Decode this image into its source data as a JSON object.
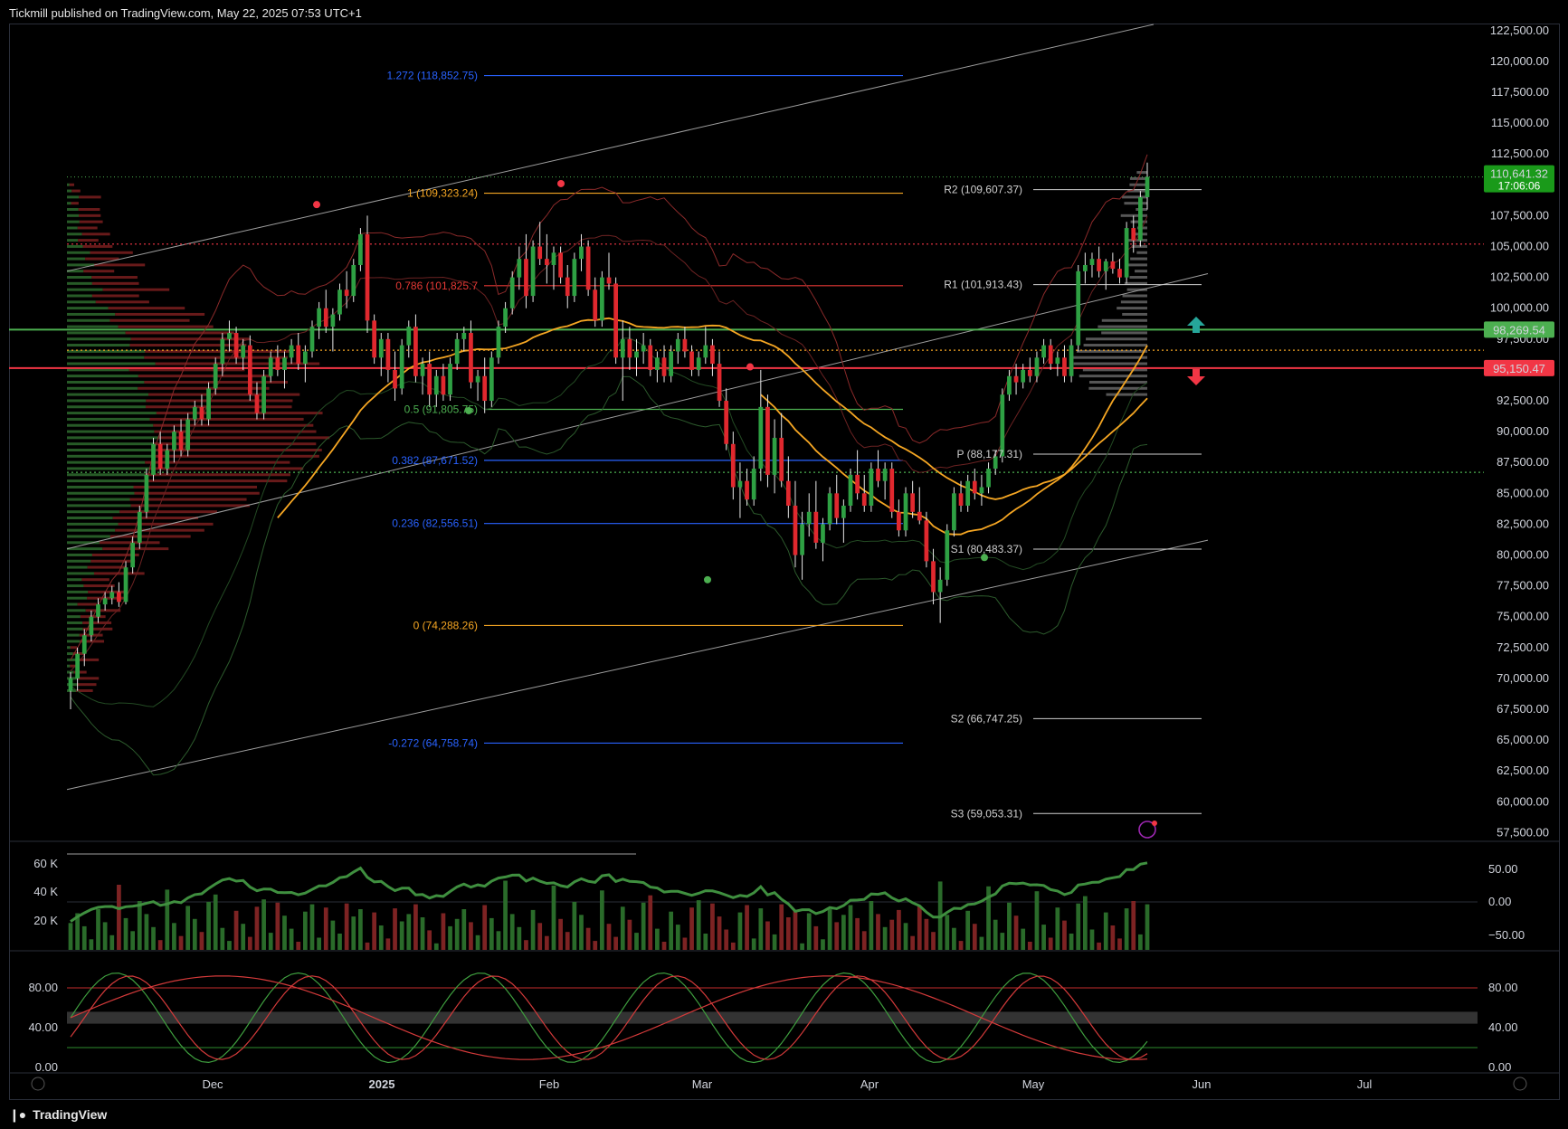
{
  "header": {
    "publisher_line": "Tickmill published on TradingView.com, May 22, 2025 07:53 UTC+1"
  },
  "footer": {
    "brand": "TradingView",
    "logo_icon": "tradingview-logo-icon"
  },
  "colors": {
    "up": "#2e8b2e",
    "down": "#c42b2b",
    "fib_blue": "#2962ff",
    "fib_orange": "#f5a623",
    "fib_red": "#e53935",
    "support": "#4caf50",
    "resistance": "#f23645",
    "ma": "#f5a623"
  },
  "chart_data": [
    {
      "type": "candlestick",
      "symbol_pane": "price",
      "y_axis_ticks": [
        "122,500.00",
        "120,000.00",
        "117,500.00",
        "115,000.00",
        "112,500.00",
        "110,000.00",
        "107,500.00",
        "105,000.00",
        "102,500.00",
        "100,000.00",
        "97,500.00",
        "92,500.00",
        "90,000.00",
        "87,500.00",
        "85,000.00",
        "82,500.00",
        "80,000.00",
        "77,500.00",
        "75,000.00",
        "72,500.00",
        "70,000.00",
        "67,500.00",
        "65,000.00",
        "62,500.00",
        "60,000.00",
        "57,500.00"
      ],
      "ylim": [
        56800,
        123000
      ],
      "x_axis_ticks": [
        "Dec",
        "2025",
        "Feb",
        "Mar",
        "Apr",
        "May",
        "Jun",
        "Jul"
      ],
      "last_price": {
        "value": "110,641.32",
        "countdown": "17:06:06"
      },
      "price_labels": [
        {
          "value": "98,269.54",
          "color": "#4caf50"
        },
        {
          "value": "95,150.47",
          "color": "#f23645"
        }
      ],
      "fib_levels": [
        {
          "label": "1.272 (118,852.75)",
          "value": 118852.75,
          "color": "#2962ff"
        },
        {
          "label": "1 (109,323.24)",
          "value": 109323.24,
          "color": "#f5a623"
        },
        {
          "label": "0.786 (101,825.7",
          "value": 101825.7,
          "color": "#e53935"
        },
        {
          "label": "0.5 (91,805.75)",
          "value": 91805.75,
          "color": "#4caf50"
        },
        {
          "label": "0.382 (87,671.52)",
          "value": 87671.52,
          "color": "#2962ff"
        },
        {
          "label": "0.236 (82,556.51)",
          "value": 82556.51,
          "color": "#2962ff"
        },
        {
          "label": "0 (74,288.26)",
          "value": 74288.26,
          "color": "#f5a623"
        },
        {
          "label": "-0.272 (64,758.74)",
          "value": 64758.74,
          "color": "#2962ff"
        }
      ],
      "pivots": [
        {
          "label": "R2 (109,607.37)",
          "value": 109607.37
        },
        {
          "label": "R1 (101,913.43)",
          "value": 101913.43
        },
        {
          "label": "P (88,177.31)",
          "value": 88177.31
        },
        {
          "label": "S1 (80,483.37)",
          "value": 80483.37
        },
        {
          "label": "S2 (66,747.25)",
          "value": 66747.25
        },
        {
          "label": "S3 (59,053.31)",
          "value": 59053.31
        }
      ],
      "candles_ohlc": [
        [
          69000,
          70500,
          67500,
          70000
        ],
        [
          70000,
          72500,
          69000,
          72000
        ],
        [
          72000,
          74000,
          71000,
          73500
        ],
        [
          73500,
          75500,
          73000,
          75000
        ],
        [
          75000,
          76500,
          74500,
          76000
        ],
        [
          76000,
          77000,
          75500,
          76500
        ],
        [
          76500,
          77500,
          76000,
          77000
        ],
        [
          77000,
          77800,
          75800,
          76200
        ],
        [
          76200,
          79500,
          76000,
          79000
        ],
        [
          79000,
          81500,
          78500,
          81000
        ],
        [
          81000,
          84000,
          80500,
          83500
        ],
        [
          83500,
          87000,
          83000,
          86500
        ],
        [
          86500,
          89500,
          86000,
          89000
        ],
        [
          89000,
          90000,
          86500,
          87000
        ],
        [
          87000,
          89000,
          86500,
          88500
        ],
        [
          88500,
          90500,
          87500,
          90000
        ],
        [
          90000,
          91000,
          88000,
          88500
        ],
        [
          88500,
          91500,
          88000,
          91000
        ],
        [
          91000,
          92500,
          90500,
          92000
        ],
        [
          92000,
          93000,
          90500,
          91000
        ],
        [
          91000,
          94000,
          90500,
          93500
        ],
        [
          93500,
          96000,
          93000,
          95500
        ],
        [
          95500,
          98000,
          94500,
          97500
        ],
        [
          97500,
          99000,
          96500,
          98000
        ],
        [
          98000,
          98500,
          95500,
          96000
        ],
        [
          96000,
          97500,
          95000,
          97000
        ],
        [
          97000,
          97800,
          92500,
          93000
        ],
        [
          93000,
          94000,
          91000,
          91500
        ],
        [
          91500,
          95000,
          91000,
          94500
        ],
        [
          94500,
          96500,
          94000,
          96000
        ],
        [
          96000,
          97000,
          94500,
          95000
        ],
        [
          95000,
          96500,
          93500,
          96000
        ],
        [
          96000,
          97500,
          95500,
          97000
        ],
        [
          97000,
          98000,
          95000,
          95500
        ],
        [
          95500,
          97000,
          94000,
          96500
        ],
        [
          96500,
          99000,
          96000,
          98500
        ],
        [
          98500,
          100500,
          97500,
          100000
        ],
        [
          100000,
          101500,
          98000,
          98500
        ],
        [
          98500,
          100000,
          96500,
          99500
        ],
        [
          99500,
          102000,
          99000,
          101500
        ],
        [
          101500,
          103000,
          100000,
          101000
        ],
        [
          101000,
          104000,
          100500,
          103500
        ],
        [
          103500,
          106500,
          103000,
          106000
        ],
        [
          106000,
          107500,
          98000,
          99000
        ],
        [
          99000,
          99500,
          95500,
          96000
        ],
        [
          96000,
          98000,
          94500,
          97500
        ],
        [
          97500,
          98000,
          94000,
          95000
        ],
        [
          95000,
          96500,
          92500,
          93500
        ],
        [
          93500,
          97500,
          93000,
          97000
        ],
        [
          97000,
          99000,
          96000,
          98500
        ],
        [
          98500,
          99500,
          94000,
          94500
        ],
        [
          94500,
          96000,
          93000,
          95500
        ],
        [
          95500,
          96500,
          92000,
          93000
        ],
        [
          93000,
          95000,
          92000,
          94500
        ],
        [
          94500,
          95500,
          92500,
          93000
        ],
        [
          93000,
          96000,
          92500,
          95500
        ],
        [
          95500,
          98000,
          95000,
          97500
        ],
        [
          97500,
          98500,
          96500,
          98000
        ],
        [
          98000,
          99000,
          93500,
          94000
        ],
        [
          94000,
          95000,
          92500,
          94500
        ],
        [
          94500,
          96000,
          91500,
          92500
        ],
        [
          92500,
          96500,
          92000,
          96000
        ],
        [
          96000,
          99000,
          95500,
          98500
        ],
        [
          98500,
          100500,
          98000,
          100000
        ],
        [
          100000,
          103000,
          99500,
          102500
        ],
        [
          102500,
          105000,
          101500,
          104000
        ],
        [
          104000,
          106000,
          100000,
          101000
        ],
        [
          101000,
          105500,
          100500,
          105000
        ],
        [
          105000,
          107000,
          103500,
          104000
        ],
        [
          104000,
          106000,
          102000,
          103500
        ],
        [
          103500,
          105000,
          101500,
          104500
        ],
        [
          104500,
          105000,
          102000,
          102500
        ],
        [
          102500,
          103500,
          100000,
          101000
        ],
        [
          101000,
          104500,
          100500,
          104000
        ],
        [
          104000,
          106000,
          103000,
          105000
        ],
        [
          105000,
          105500,
          101000,
          101500
        ],
        [
          101500,
          102500,
          98500,
          99000
        ],
        [
          99000,
          103000,
          98500,
          102500
        ],
        [
          102500,
          104500,
          101500,
          102000
        ],
        [
          102000,
          102500,
          95500,
          96000
        ],
        [
          96000,
          99000,
          92500,
          97500
        ],
        [
          97500,
          98500,
          95000,
          96000
        ],
        [
          96000,
          97500,
          94500,
          96500
        ],
        [
          96500,
          98000,
          95500,
          97000
        ],
        [
          97000,
          97500,
          94500,
          95000
        ],
        [
          95000,
          96500,
          94000,
          96000
        ],
        [
          96000,
          97000,
          94000,
          94500
        ],
        [
          94500,
          97000,
          94000,
          96500
        ],
        [
          96500,
          98000,
          95500,
          97500
        ],
        [
          97500,
          98500,
          96000,
          96500
        ],
        [
          96500,
          97000,
          94500,
          95000
        ],
        [
          95000,
          96500,
          94500,
          96000
        ],
        [
          96000,
          98500,
          95500,
          97000
        ],
        [
          97000,
          97500,
          94500,
          95500
        ],
        [
          95500,
          96500,
          92000,
          92500
        ],
        [
          92500,
          93500,
          88500,
          89000
        ],
        [
          89000,
          90000,
          84500,
          85500
        ],
        [
          85500,
          87500,
          83000,
          86000
        ],
        [
          86000,
          87000,
          84000,
          84500
        ],
        [
          84500,
          88000,
          84000,
          87000
        ],
        [
          87000,
          95000,
          86000,
          92000
        ],
        [
          92000,
          93000,
          85500,
          86500
        ],
        [
          86500,
          91000,
          85000,
          89500
        ],
        [
          89500,
          91500,
          85500,
          86000
        ],
        [
          86000,
          88000,
          83000,
          84000
        ],
        [
          84000,
          86000,
          79000,
          80000
        ],
        [
          80000,
          83500,
          78000,
          82500
        ],
        [
          82500,
          85000,
          81500,
          83500
        ],
        [
          83500,
          86000,
          80500,
          81000
        ],
        [
          81000,
          83000,
          79500,
          82500
        ],
        [
          82500,
          85500,
          82000,
          85000
        ],
        [
          85000,
          86500,
          82500,
          83000
        ],
        [
          83000,
          84500,
          81000,
          84000
        ],
        [
          84000,
          87000,
          83500,
          86500
        ],
        [
          86500,
          88500,
          84500,
          85000
        ],
        [
          85000,
          86500,
          83500,
          84000
        ],
        [
          84000,
          87500,
          83500,
          87000
        ],
        [
          87000,
          88500,
          85500,
          86000
        ],
        [
          86000,
          87500,
          84500,
          87000
        ],
        [
          87000,
          87500,
          83000,
          83500
        ],
        [
          83500,
          84500,
          81500,
          82000
        ],
        [
          82000,
          85500,
          81500,
          85000
        ],
        [
          85000,
          86000,
          83000,
          83500
        ],
        [
          83500,
          85500,
          82500,
          82800
        ],
        [
          82800,
          83500,
          79000,
          79500
        ],
        [
          79500,
          80500,
          76000,
          77000
        ],
        [
          77000,
          79000,
          74500,
          78000
        ],
        [
          78000,
          82500,
          77500,
          82000
        ],
        [
          82000,
          85500,
          81500,
          85000
        ],
        [
          85000,
          86000,
          83500,
          84000
        ],
        [
          84000,
          86500,
          83500,
          86000
        ],
        [
          86000,
          87000,
          84500,
          85000
        ],
        [
          85000,
          86500,
          84000,
          85500
        ],
        [
          85500,
          87500,
          85000,
          87000
        ],
        [
          87000,
          88500,
          86500,
          88000
        ],
        [
          88000,
          93500,
          87500,
          93000
        ],
        [
          93000,
          95000,
          92500,
          94500
        ],
        [
          94500,
          95500,
          93000,
          94000
        ],
        [
          94000,
          95500,
          93500,
          95000
        ],
        [
          95000,
          96000,
          94000,
          94500
        ],
        [
          94500,
          96500,
          94000,
          96000
        ],
        [
          96000,
          97500,
          95500,
          97000
        ],
        [
          97000,
          97500,
          95000,
          95500
        ],
        [
          95500,
          96500,
          94500,
          96000
        ],
        [
          96000,
          97000,
          94000,
          94500
        ],
        [
          94500,
          97500,
          94000,
          97000
        ],
        [
          97000,
          103500,
          96500,
          103000
        ],
        [
          103000,
          104500,
          102000,
          103500
        ],
        [
          103500,
          104500,
          102500,
          104000
        ],
        [
          104000,
          105000,
          102500,
          103000
        ],
        [
          103000,
          104000,
          101500,
          103800
        ],
        [
          103800,
          104500,
          102800,
          103200
        ],
        [
          103200,
          104000,
          102000,
          102500
        ],
        [
          102500,
          107000,
          102000,
          106500
        ],
        [
          106500,
          107500,
          104500,
          105500
        ],
        [
          105500,
          109500,
          105000,
          109000
        ],
        [
          109000,
          111800,
          108000,
          110641
        ]
      ],
      "volume_axis_ticks": [
        "60 K",
        "40 K",
        "20 K"
      ],
      "volume_osc_ticks": [
        "50.00",
        "0.00",
        "−50.00"
      ],
      "stoch_ticks": [
        "80.00",
        "40.00",
        "0.00"
      ]
    }
  ]
}
